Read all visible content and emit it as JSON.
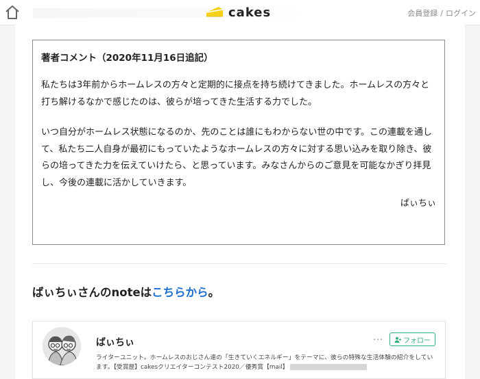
{
  "header": {
    "site_name": "cakes",
    "auth": {
      "register": "会員登録",
      "separator": "/",
      "login": "ログイン"
    }
  },
  "comment": {
    "title": "著者コメント（2020年11月16日追記）",
    "paragraphs": [
      "私たちは3年前からホームレスの方々と定期的に接点を持ち続けてきました。ホームレスの方々と打ち解けるなかで感じたのは、彼らが培ってきた生活する力でした。",
      "いつ自分がホームレス状態になるのか、先のことは誰にもわからない世の中です。この連載を通して、私たち二人自身が最初にもっていたようなホームレスの方々に対する思い込みを取り除き、彼らの培ってきた力を伝えていけたら、と思っています。みなさんからのご意見を可能なかぎり拝見し、今後の連載に活かしていきます。"
    ],
    "signature": "ばぃちぃ"
  },
  "note_link": {
    "prefix": "ばぃちぃさんのnoteは",
    "link_text": "こちらから",
    "suffix": "。"
  },
  "profile": {
    "name": "ばぃちぃ",
    "more": "···",
    "follow_label": "フォロー",
    "bio": "ライターユニット。ホームレスのおじさん達の「生きていくエネルギー」をテーマに、彼らの特殊な生活体験の紹介をしています。【受賞歴】cakesクリエイターコンテスト2020／優秀賞【mail】"
  },
  "colors": {
    "accent_link": "#1f6fd0",
    "follow_green": "#2fb07a",
    "logo_yellow": "#f5d11a"
  }
}
